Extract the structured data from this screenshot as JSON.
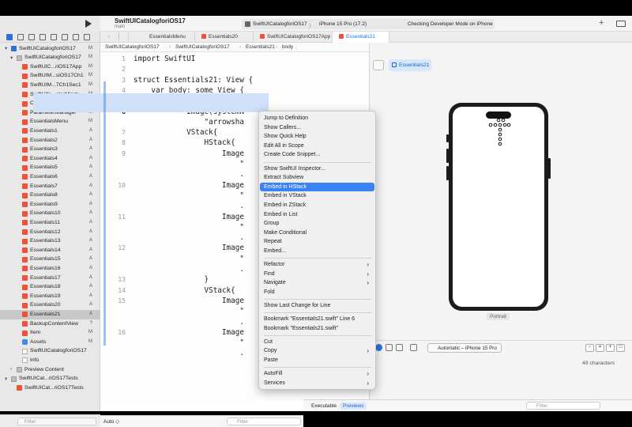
{
  "window": {
    "project_title": "SwiftUICatalogforiOS17",
    "branch": "main"
  },
  "scheme": {
    "name": "SwiftUICatalogforiOS17",
    "separator": "〉",
    "device": "iPhone 15 Pro (17.2)",
    "status": "Checking Developer Mode on iPhone"
  },
  "tabs": [
    {
      "label": "EssentialsMenu"
    },
    {
      "label": "Essentials20"
    },
    {
      "label": "SwiftUICatalogforiOS17App"
    },
    {
      "label": "Essentials21"
    }
  ],
  "jumpbar": {
    "items": [
      "SwiftUICatalogforiOS17",
      "SwiftUICatalogforiOS17",
      "Essentials21",
      "body"
    ]
  },
  "navigator": {
    "rows": [
      {
        "name": "SwiftUICatalogforiOS17",
        "tag": "M",
        "icon": "project-icon",
        "disc": "▾"
      },
      {
        "name": "SwiftUICatalogforiOS17",
        "tag": "M",
        "icon": "folder-icon",
        "disc": "▾"
      },
      {
        "name": "SwiftUIC...riOS17App",
        "tag": "M",
        "icon": "swift-file-icon"
      },
      {
        "name": "SwiftUIM...siOS17Ch1",
        "tag": "M",
        "icon": "swift-file-icon"
      },
      {
        "name": "SwiftUIM...7Ch1Sec1",
        "tag": "M",
        "icon": "swift-file-icon"
      },
      {
        "name": "SwiftUIfo...sterMinds",
        "tag": "M",
        "icon": "swift-file-icon"
      },
      {
        "name": "ContentView",
        "tag": "M",
        "icon": "swift-file-icon"
      },
      {
        "name": "ParameterManager",
        "tag": "M",
        "icon": "swift-file-icon"
      },
      {
        "name": "EssentialsMenu",
        "tag": "M",
        "icon": "swift-file-icon"
      },
      {
        "name": "Essentials1",
        "tag": "A",
        "icon": "swift-file-icon"
      },
      {
        "name": "Essentials2",
        "tag": "A",
        "icon": "swift-file-icon"
      },
      {
        "name": "Essentials3",
        "tag": "A",
        "icon": "swift-file-icon"
      },
      {
        "name": "Essentials4",
        "tag": "A",
        "icon": "swift-file-icon"
      },
      {
        "name": "Essentials5",
        "tag": "A",
        "icon": "swift-file-icon"
      },
      {
        "name": "Essentials6",
        "tag": "A",
        "icon": "swift-file-icon"
      },
      {
        "name": "Essentials7",
        "tag": "A",
        "icon": "swift-file-icon"
      },
      {
        "name": "Essentials8",
        "tag": "A",
        "icon": "swift-file-icon"
      },
      {
        "name": "Essentials9",
        "tag": "A",
        "icon": "swift-file-icon"
      },
      {
        "name": "Essentials10",
        "tag": "A",
        "icon": "swift-file-icon"
      },
      {
        "name": "Essentials11",
        "tag": "A",
        "icon": "swift-file-icon"
      },
      {
        "name": "Essentials12",
        "tag": "A",
        "icon": "swift-file-icon"
      },
      {
        "name": "Essentials13",
        "tag": "A",
        "icon": "swift-file-icon"
      },
      {
        "name": "Essentials14",
        "tag": "A",
        "icon": "swift-file-icon"
      },
      {
        "name": "Essentials15",
        "tag": "A",
        "icon": "swift-file-icon"
      },
      {
        "name": "Essentials16",
        "tag": "A",
        "icon": "swift-file-icon"
      },
      {
        "name": "Essentials17",
        "tag": "A",
        "icon": "swift-file-icon"
      },
      {
        "name": "Essentials18",
        "tag": "A",
        "icon": "swift-file-icon"
      },
      {
        "name": "Essentials19",
        "tag": "A",
        "icon": "swift-file-icon"
      },
      {
        "name": "Essentials20",
        "tag": "A",
        "icon": "swift-file-icon"
      },
      {
        "name": "Essentials21",
        "tag": "A",
        "icon": "swift-file-icon",
        "selected": true
      },
      {
        "name": "BackupContentView",
        "tag": "?",
        "icon": "swift-file-icon"
      },
      {
        "name": "Item",
        "tag": "M",
        "icon": "swift-file-icon"
      },
      {
        "name": "Assets",
        "tag": "M",
        "icon": "assets-icon"
      },
      {
        "name": "SwiftUICatalogforiOS17",
        "tag": "",
        "icon": "file-icon"
      },
      {
        "name": "Info",
        "tag": "",
        "icon": "file-icon"
      },
      {
        "name": "Preview Content",
        "tag": "",
        "icon": "folder-icon",
        "disc": "›"
      },
      {
        "name": "SwiftUICat...riOS17Tests",
        "tag": "",
        "icon": "folder-icon",
        "disc": "▾"
      },
      {
        "name": "SwiftUICat...riOS17Tests",
        "tag": "",
        "icon": "swift-file-icon"
      }
    ],
    "filter_placeholder": "Filter"
  },
  "editor": {
    "lines": [
      {
        "n": "1",
        "text": "import SwiftUI"
      },
      {
        "n": "2",
        "text": ""
      },
      {
        "n": "3",
        "text": "struct Essentials21: View {"
      },
      {
        "n": "4",
        "text": "    var body: some View {"
      },
      {
        "n": "5",
        "text": "        ScrollView{"
      },
      {
        "n": "6",
        "text": "            Image(systemN"
      },
      {
        "n": "",
        "text": "                \"arrowsha"
      },
      {
        "n": "7",
        "text": "            VStack{"
      },
      {
        "n": "8",
        "text": "                HStack{"
      },
      {
        "n": "9",
        "text": "                    Image"
      },
      {
        "n": "",
        "text": "                        \""
      },
      {
        "n": "",
        "text": "                        ."
      },
      {
        "n": "10",
        "text": "                    Image"
      },
      {
        "n": "",
        "text": "                        \""
      },
      {
        "n": "",
        "text": "                        ."
      },
      {
        "n": "11",
        "text": "                    Image"
      },
      {
        "n": "",
        "text": "                        \""
      },
      {
        "n": "",
        "text": "                        ."
      },
      {
        "n": "12",
        "text": "                    Image"
      },
      {
        "n": "",
        "text": "                        \""
      },
      {
        "n": "",
        "text": "                        ."
      },
      {
        "n": "13",
        "text": "                }"
      },
      {
        "n": "14",
        "text": "                VStack{"
      },
      {
        "n": "15",
        "text": "                    Image"
      },
      {
        "n": "",
        "text": "                        \""
      },
      {
        "n": "",
        "text": "                        ."
      },
      {
        "n": "16",
        "text": "                    Image"
      },
      {
        "n": "",
        "text": "                        \""
      },
      {
        "n": "",
        "text": "                        ."
      }
    ],
    "status_left": "Auto ◇",
    "filter_placeholder": "Filter"
  },
  "context_menu": {
    "items": [
      {
        "label": "Jump to Definition"
      },
      {
        "label": "Show Callers..."
      },
      {
        "label": "Show Quick Help"
      },
      {
        "label": "Edit All in Scope"
      },
      {
        "label": "Create Code Snippet..."
      },
      {
        "sep": true
      },
      {
        "label": "Show SwiftUI Inspector..."
      },
      {
        "label": "Extract Subview"
      },
      {
        "label": "Embed in HStack",
        "highlighted": true
      },
      {
        "label": "Embed in VStack"
      },
      {
        "label": "Embed in ZStack"
      },
      {
        "label": "Embed in List"
      },
      {
        "label": "Group"
      },
      {
        "label": "Make Conditional"
      },
      {
        "label": "Repeat"
      },
      {
        "label": "Embed..."
      },
      {
        "sep": true
      },
      {
        "label": "Refactor",
        "submenu": true
      },
      {
        "label": "Find",
        "submenu": true
      },
      {
        "label": "Navigate",
        "submenu": true
      },
      {
        "label": "Fold"
      },
      {
        "sep": true
      },
      {
        "label": "Show Last Change for Line"
      },
      {
        "sep": true
      },
      {
        "label": "Bookmark \"Essentials21.swift\" Line 6"
      },
      {
        "label": "Bookmark \"Essentials21.swift\""
      },
      {
        "sep": true
      },
      {
        "label": "Cut"
      },
      {
        "label": "Copy",
        "submenu": true
      },
      {
        "label": "Paste"
      },
      {
        "sep": true
      },
      {
        "label": "AutoFill",
        "submenu": true
      },
      {
        "label": "Services",
        "submenu": true
      }
    ]
  },
  "canvas": {
    "preview_chip": "Essentials21",
    "orientation_label": "Portrait",
    "device_selector": "Automatic – iPhone 15 Pro",
    "chars": "49 characters",
    "mode_executable": "Executable",
    "mode_previews": "Previews"
  },
  "colors": {
    "accent": "#3b82f6",
    "swift_orange": "#f05138"
  }
}
